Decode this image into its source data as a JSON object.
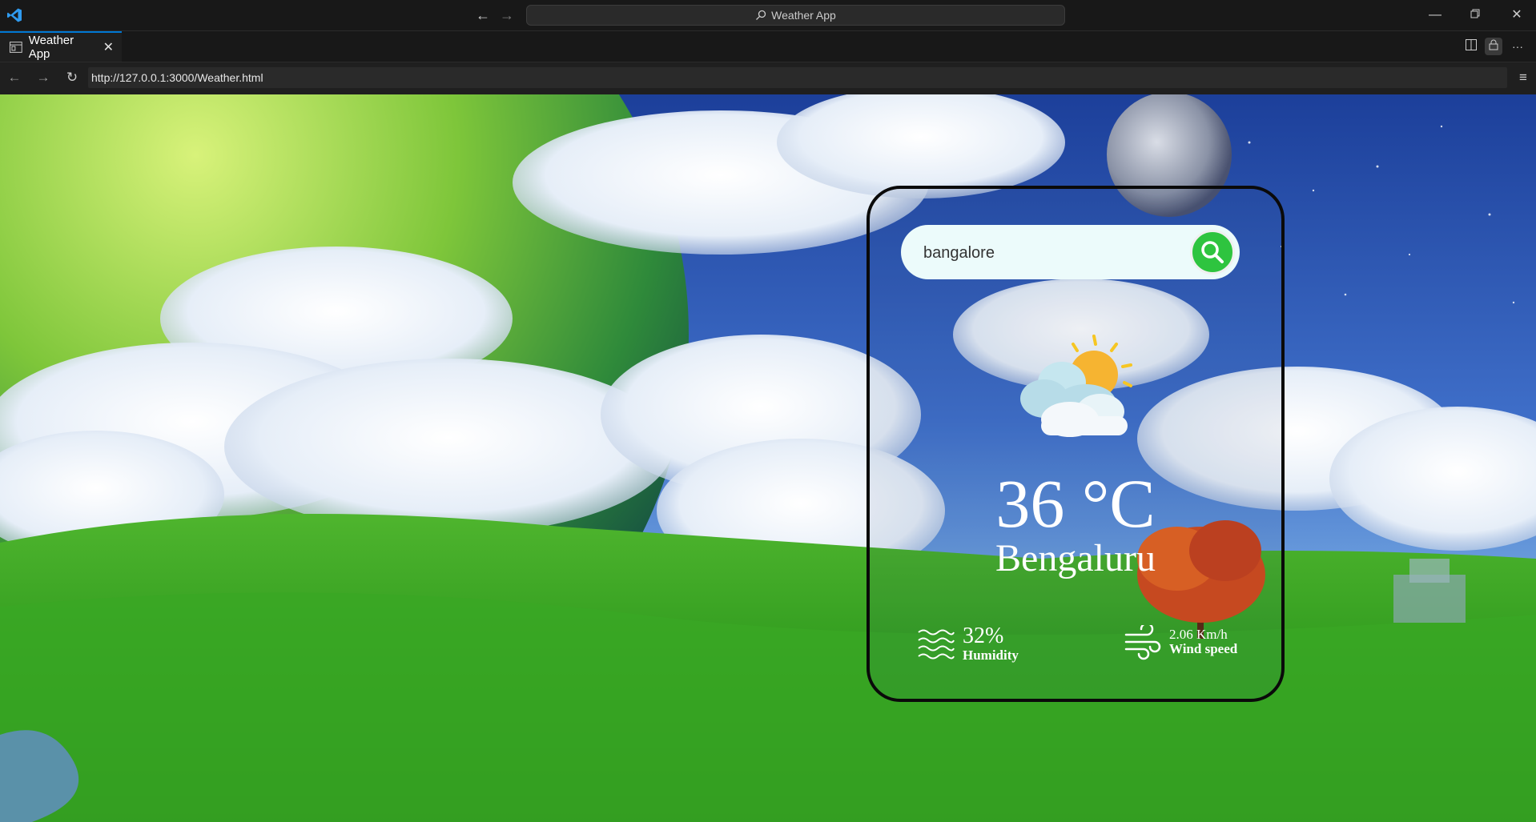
{
  "window": {
    "title": "Weather App"
  },
  "tab": {
    "label": "Weather App",
    "close_symbol": "✕"
  },
  "address_bar": {
    "url": "http://127.0.0.1:3000/Weather.html"
  },
  "weather": {
    "search_value": "bangalore",
    "temperature": "36 °C",
    "city": "Bengaluru",
    "humidity_value": "32%",
    "humidity_label": "Humidity",
    "wind_value": "2.06 Km/h",
    "wind_label": "Wind speed",
    "condition_icon": "sun-behind-clouds-icon"
  },
  "colors": {
    "accent": "#0078d4",
    "search_button": "#2ec43f",
    "search_bg": "#ecfbfb",
    "card_border": "#0a0a0a"
  }
}
